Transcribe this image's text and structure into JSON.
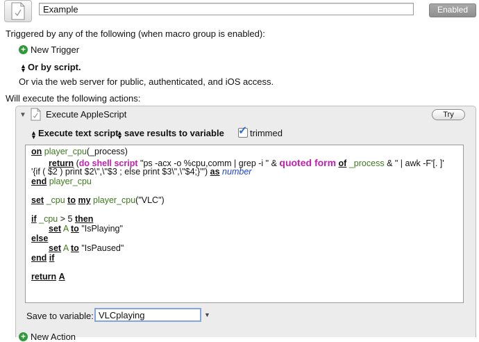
{
  "header": {
    "macro_name": "Example",
    "enabled_label": "Enabled"
  },
  "triggers": {
    "heading": "Triggered by any of the following (when macro group is enabled):",
    "new_trigger_label": "New Trigger",
    "or_by_script_label": "Or by script.",
    "web_server_text": "Or via the web server for public, authenticated, and iOS access."
  },
  "actions": {
    "heading": "Will execute the following actions:",
    "action_title": "Execute AppleScript",
    "try_label": "Try",
    "execute_mode_label": "Execute text script",
    "results_mode_label": "save results to variable",
    "trimmed_label": "trimmed",
    "trimmed_checked": true,
    "save_to_variable_label": "Save to variable:",
    "save_to_variable_value": "VLCplaying",
    "new_action_label": "New Action"
  },
  "script": {
    "l1_on": "on",
    "l1_fn": "player_cpu",
    "l1_rest": "(_process)",
    "l2_return": "return",
    "l2_paren": "(",
    "l2_cmd": "do shell script",
    "l2_str1": "\"ps -acx -o %cpu,comm | grep -i \" &",
    "l2_quoted": "quoted form",
    "l2_of": "of",
    "l2_var": "_process",
    "l2_str2": "& \" | awk  -F'[. ]'",
    "l3_str": "'{if ( $2 )  print $2\\\",\\\"$3 ; else print $3\\\",\\\"$4;}'\")",
    "l3_as": "as",
    "l3_class": "number",
    "l4_end": "end",
    "l4_fn": "player_cpu",
    "l6_set": "set",
    "l6_var": "_cpu",
    "l6_to": "to",
    "l6_my": "my",
    "l6_fn": "player_cpu",
    "l6_arg": "(\"VLC\")",
    "l8_if": "if",
    "l8_var": "_cpu",
    "l8_cmp": "> 5",
    "l8_then": "then",
    "l9_set": "set",
    "l9_var": "A",
    "l9_to": "to",
    "l9_val": "\"IsPlaying\"",
    "l10_else": "else",
    "l11_set": "set",
    "l11_var": "A",
    "l11_to": "to",
    "l11_val": "\"IsPaused\"",
    "l12_end": "end",
    "l12_if": "if",
    "l14_return": "return",
    "l14_var": "A"
  },
  "colors": {
    "keyword": "#111111",
    "function": "#3d7a1d",
    "command": "#c21fb0",
    "class": "#1a3fd9",
    "add_icon": "#2f9a3a",
    "focus_ring": "#7fa6e3"
  },
  "icons": {
    "macro_icon": "script-document-icon",
    "action_icon": "applescript-document-icon",
    "add_icon": "plus-circle-icon",
    "popup_icon": "up-down-arrows-icon",
    "disclosure_icon": "disclosure-triangle-down-icon"
  }
}
